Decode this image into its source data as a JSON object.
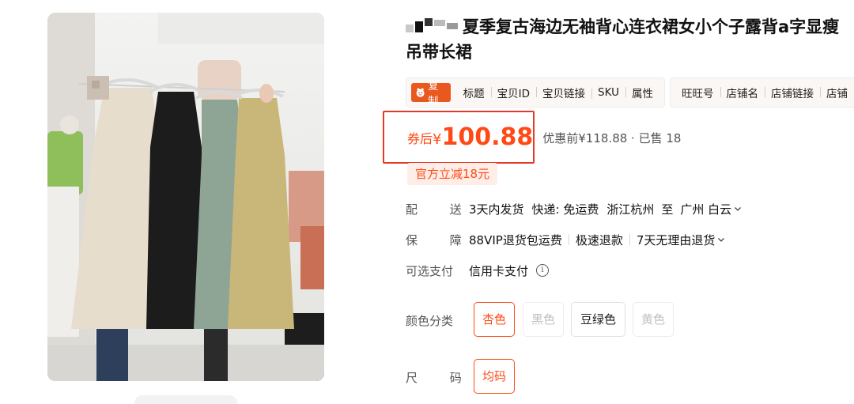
{
  "product": {
    "title": "夏季复古海边无袖背心连衣裙女小个子露背a字显瘦吊带长裙"
  },
  "toolbar": {
    "copy_label": "复制",
    "group1": [
      "标题",
      "宝贝ID",
      "宝贝链接",
      "SKU",
      "属性"
    ],
    "group2": [
      "旺旺号",
      "店铺名",
      "店铺链接",
      "店铺"
    ]
  },
  "price": {
    "prefix": "券后",
    "currency": "¥",
    "value": "100.88",
    "meta": "优惠前¥118.88 · 已售 18"
  },
  "coupon": {
    "label": "官方立减18元"
  },
  "delivery": {
    "label": "配 送",
    "time": "3天内发货",
    "express": "快递: 免运费",
    "from": "浙江杭州",
    "to_word": "至",
    "dest": "广州 白云"
  },
  "guarantee": {
    "label": "保 障",
    "items": [
      "88VIP退货包运费",
      "极速退款",
      "7天无理由退货"
    ]
  },
  "payment": {
    "label": "可选支付",
    "value": "信用卡支付"
  },
  "color": {
    "label": "颜色分类",
    "options": [
      {
        "name": "杏色",
        "state": "selected"
      },
      {
        "name": "黑色",
        "state": "disabled"
      },
      {
        "name": "豆绿色",
        "state": "normal"
      },
      {
        "name": "黄色",
        "state": "disabled"
      }
    ]
  },
  "size": {
    "label": "尺 码",
    "options": [
      {
        "name": "均码",
        "state": "selected"
      }
    ]
  },
  "colors": {
    "accent": "#ff4a17",
    "highlight_box": "#e23b2a",
    "copy_button": "#e8581f"
  }
}
